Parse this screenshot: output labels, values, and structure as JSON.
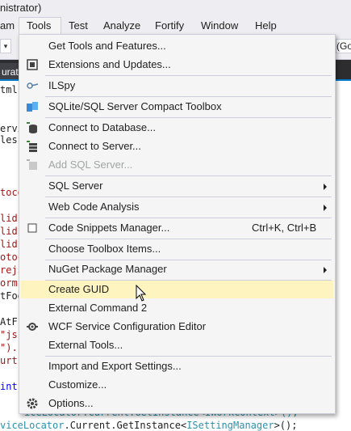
{
  "window": {
    "title_fragment": "nistrator)"
  },
  "menubar": {
    "items": [
      {
        "label": "am",
        "active": false
      },
      {
        "label": "Tools",
        "active": true
      },
      {
        "label": "Test",
        "active": false
      },
      {
        "label": "Analyze",
        "active": false
      },
      {
        "label": "Fortify",
        "active": false
      },
      {
        "label": "Window",
        "active": false
      },
      {
        "label": "Help",
        "active": false
      }
    ]
  },
  "toolbar": {
    "right_fragment": "(Go"
  },
  "tabstrip": {
    "tab_fragment": "urati"
  },
  "editor": {
    "lines": [
      {
        "text": "tml",
        "color": "c-dark"
      },
      {
        "text": "",
        "color": "c-dark"
      },
      {
        "text": "ervi",
        "color": "c-dark"
      },
      {
        "text": "les",
        "color": "c-dark"
      },
      {
        "text": "toco",
        "color": "c-red"
      },
      {
        "text": "lid",
        "color": "c-red"
      },
      {
        "text": "lid",
        "color": "c-red"
      },
      {
        "text": "lid",
        "color": "c-red"
      },
      {
        "text": "otoc",
        "color": "c-red"
      },
      {
        "text": "rejs",
        "color": "c-red"
      },
      {
        "text": "orm\"",
        "color": "c-red"
      },
      {
        "text": "tFoo",
        "color": "c-dark"
      },
      {
        "text": "AtF",
        "color": "c-dark"
      },
      {
        "text": "\"js\"",
        "color": "c-red"
      },
      {
        "text": "\").",
        "color": "c-red"
      },
      {
        "text": "urt-",
        "color": "c-red"
      },
      {
        "text": "int)",
        "color": "c-blue"
      }
    ],
    "bottom_line_1": "iceLocator.Current.GetInstance<IWorkContext>();",
    "bottom_line_2_a": "viceLocator",
    "bottom_line_2_b": ".Current.GetInstance<",
    "bottom_line_2_c": "ISettingManager",
    "bottom_line_2_d": ">();"
  },
  "dropdown": {
    "items": [
      {
        "label": "Get Tools and Features...",
        "icon": "",
        "shortcut": "",
        "submenu": false,
        "disabled": false,
        "highlight": false
      },
      {
        "label": "Extensions and Updates...",
        "icon": "extensions-icon",
        "shortcut": "",
        "submenu": false,
        "disabled": false,
        "highlight": false
      },
      {
        "label": "ILSpy",
        "icon": "ilspy-icon",
        "shortcut": "",
        "submenu": false,
        "disabled": false,
        "highlight": false
      },
      {
        "label": "SQLite/SQL Server Compact Toolbox",
        "icon": "sqlite-toolbox-icon",
        "shortcut": "",
        "submenu": false,
        "disabled": false,
        "highlight": false
      },
      {
        "label": "Connect to Database...",
        "icon": "connect-database-icon",
        "shortcut": "",
        "submenu": false,
        "disabled": false,
        "highlight": false
      },
      {
        "label": "Connect to Server...",
        "icon": "connect-server-icon",
        "shortcut": "",
        "submenu": false,
        "disabled": false,
        "highlight": false
      },
      {
        "label": "Add SQL Server...",
        "icon": "add-sql-server-icon",
        "shortcut": "",
        "submenu": false,
        "disabled": true,
        "highlight": false
      },
      {
        "label": "SQL Server",
        "icon": "",
        "shortcut": "",
        "submenu": true,
        "disabled": false,
        "highlight": false
      },
      {
        "label": "Web Code Analysis",
        "icon": "",
        "shortcut": "",
        "submenu": true,
        "disabled": false,
        "highlight": false
      },
      {
        "label": "Code Snippets Manager...",
        "icon": "checkbox-icon",
        "shortcut": "Ctrl+K, Ctrl+B",
        "submenu": false,
        "disabled": false,
        "highlight": false
      },
      {
        "label": "Choose Toolbox Items...",
        "icon": "",
        "shortcut": "",
        "submenu": false,
        "disabled": false,
        "highlight": false
      },
      {
        "label": "NuGet Package Manager",
        "icon": "",
        "shortcut": "",
        "submenu": true,
        "disabled": false,
        "highlight": false
      },
      {
        "label": "Create GUID",
        "icon": "",
        "shortcut": "",
        "submenu": false,
        "disabled": false,
        "highlight": true
      },
      {
        "label": "External Command 2",
        "icon": "",
        "shortcut": "",
        "submenu": false,
        "disabled": false,
        "highlight": false
      },
      {
        "label": "WCF Service Configuration Editor",
        "icon": "wcf-config-icon",
        "shortcut": "",
        "submenu": false,
        "disabled": false,
        "highlight": false
      },
      {
        "label": "External Tools...",
        "icon": "",
        "shortcut": "",
        "submenu": false,
        "disabled": false,
        "highlight": false
      },
      {
        "label": "Import and Export Settings...",
        "icon": "",
        "shortcut": "",
        "submenu": false,
        "disabled": false,
        "highlight": false
      },
      {
        "label": "Customize...",
        "icon": "",
        "shortcut": "",
        "submenu": false,
        "disabled": false,
        "highlight": false
      },
      {
        "label": "Options...",
        "icon": "gear-icon",
        "shortcut": "",
        "submenu": false,
        "disabled": false,
        "highlight": false
      }
    ]
  },
  "colors": {
    "menu_bg": "#f5f5f5",
    "menu_border": "#cccedb",
    "highlight": "#fdf4bf",
    "disabled_text": "#a2a4a5",
    "accent": "#007acc"
  }
}
